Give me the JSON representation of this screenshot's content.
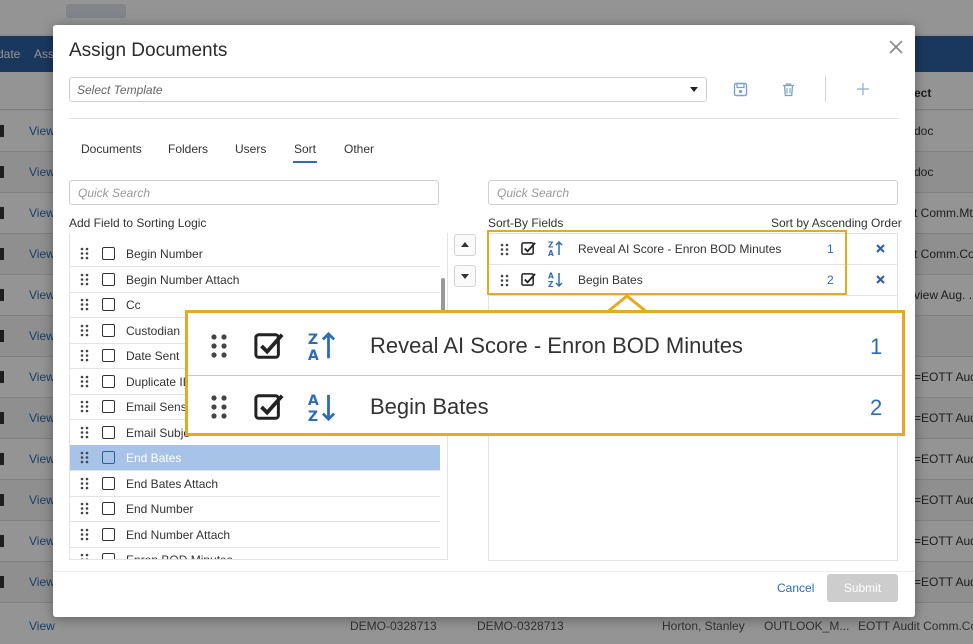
{
  "background": {
    "nav_items": [
      "date",
      "Ass"
    ],
    "header_subject": "ect",
    "view_label": "View",
    "subjects": [
      "doc",
      "doc",
      "t Comm.Mt",
      "t Comm.Co.",
      "view Aug. ...",
      "",
      "=EOTT Audi",
      "=EOTT Audi",
      "=EOTT Audi",
      "=EOTT Audi",
      "=EOTT Audi",
      "=EOTT Audi",
      "t Comm.Mt"
    ],
    "last_row": {
      "view": "View",
      "doc1": "DEMO-0328713",
      "doc2": "DEMO-0328713",
      "custodian": "Horton, Stanley",
      "type": "OUTLOOK_M...",
      "subject": "EOTT Audit Comm.Co..."
    }
  },
  "modal": {
    "title": "Assign Documents",
    "template_placeholder": "Select Template",
    "tabs": [
      {
        "label": "Documents",
        "active": false
      },
      {
        "label": "Folders",
        "active": false
      },
      {
        "label": "Users",
        "active": false
      },
      {
        "label": "Sort",
        "active": true
      },
      {
        "label": "Other",
        "active": false
      }
    ],
    "left_search_placeholder": "Quick Search",
    "right_search_placeholder": "Quick Search",
    "add_field_label": "Add Field to Sorting Logic",
    "sort_by_label": "Sort-By Fields",
    "sort_order_label": "Sort by Ascending Order",
    "available_fields": [
      {
        "label": "Begin Number",
        "selected": false
      },
      {
        "label": "Begin Number Attach",
        "selected": false
      },
      {
        "label": "Cc",
        "selected": false
      },
      {
        "label": "Custodian",
        "selected": false
      },
      {
        "label": "Date Sent",
        "selected": false
      },
      {
        "label": "Duplicate IL",
        "selected": false
      },
      {
        "label": "Email Sens",
        "selected": false
      },
      {
        "label": "Email Subje",
        "selected": false
      },
      {
        "label": "End Bates",
        "selected": true
      },
      {
        "label": "End Bates Attach",
        "selected": false
      },
      {
        "label": "End Number",
        "selected": false
      },
      {
        "label": "End Number Attach",
        "selected": false
      },
      {
        "label": "Enron BOD Minutes",
        "selected": false
      }
    ],
    "sort_fields": [
      {
        "label": "Reveal AI Score - Enron BOD Minutes",
        "rank": "1",
        "order": "descending"
      },
      {
        "label": "Begin Bates",
        "rank": "2",
        "order": "ascending"
      }
    ],
    "cancel_label": "Cancel",
    "submit_label": "Submit"
  },
  "callout": {
    "rows": [
      {
        "label": "Reveal AI Score - Enron BOD Minutes",
        "rank": "1",
        "order": "descending"
      },
      {
        "label": "Begin Bates",
        "rank": "2",
        "order": "ascending"
      }
    ]
  },
  "colors": {
    "accent": "#2d6db5",
    "highlight": "#e4aa22",
    "selected_row": "#a7c3e8",
    "navbar": "#2d5fa0"
  }
}
